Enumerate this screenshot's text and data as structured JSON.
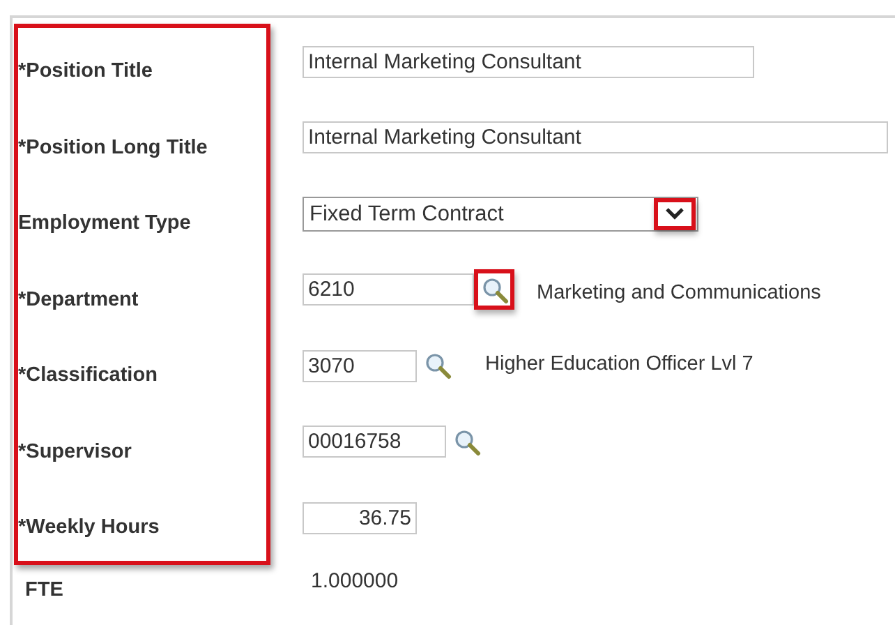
{
  "labels_highlighted": true,
  "fields": [
    {
      "kind": "text",
      "label": "*Position Title",
      "value": "Internal Marketing Consultant"
    },
    {
      "kind": "text",
      "label": "*Position Long Title",
      "value": "Internal Marketing Consultant"
    },
    {
      "kind": "select",
      "label": "Employment Type",
      "value": "Fixed Term Contract",
      "highlighted": true
    },
    {
      "kind": "lookup",
      "label": "*Department",
      "value": "6210",
      "highlighted": true,
      "description": "Marketing and Communications"
    },
    {
      "kind": "lookup",
      "label": "*Classification",
      "value": "3070",
      "highlighted": false,
      "description": "Higher Education Officer Lvl 7"
    },
    {
      "kind": "lookup",
      "label": "*Supervisor",
      "value": "00016758",
      "highlighted": false
    },
    {
      "kind": "number",
      "label": "*Weekly Hours",
      "value": "36.75"
    },
    {
      "kind": "display",
      "label": "FTE",
      "value": "1.000000"
    }
  ]
}
